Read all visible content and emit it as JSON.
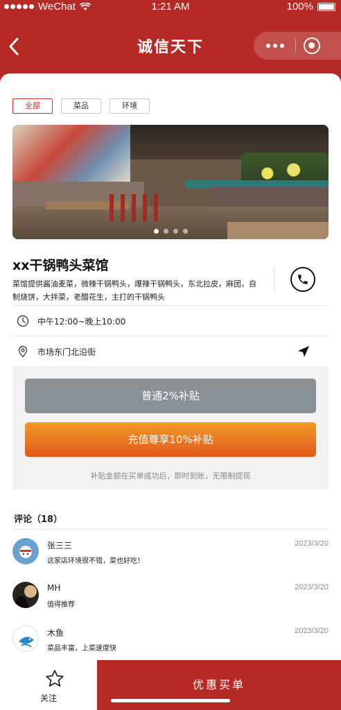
{
  "status_bar": {
    "carrier": "WeChat",
    "time": "1:21 AM",
    "battery": "100%"
  },
  "nav": {
    "title": "诚信天下"
  },
  "tabs": [
    {
      "label": "全部",
      "active": true
    },
    {
      "label": "菜品",
      "active": false
    },
    {
      "label": "环境",
      "active": false
    }
  ],
  "banner": {
    "slide_count": 4,
    "active_slide": 1
  },
  "shop": {
    "name": "xx干锅鸭头菜馆",
    "description": "菜馆提供酱油麦菜，微辣干锅鸭头，爆辣干锅鸭头，东北拉皮，麻团，自制烧饼，大拌菜，老醋花生，主打的干锅鸭头",
    "hours": "中午12:00~晚上10:00",
    "address": "市场东门北沿街"
  },
  "subsidy": {
    "normal_label": "普通2%补贴",
    "vip_label": "充值尊享10%补贴",
    "note": "补贴金额在买单成功后，即时到账，无限制提现"
  },
  "reviews": {
    "title": "评论（18）",
    "items": [
      {
        "name": "张三三",
        "date": "2023/3/20",
        "text": "这家店环境很不错，菜也好吃！"
      },
      {
        "name": "MH",
        "date": "2023/3/20",
        "text": "值得推荐"
      },
      {
        "name": "木鱼",
        "date": "2023/3/20",
        "text": "菜品丰富，上菜速度快"
      }
    ]
  },
  "bottom_bar": {
    "favorite_label": "关注",
    "buy_label": "优惠买单"
  },
  "colors": {
    "brand_red": "#b52a26",
    "accent_orange": "#e0591a",
    "muted_gray": "#8a9196"
  }
}
